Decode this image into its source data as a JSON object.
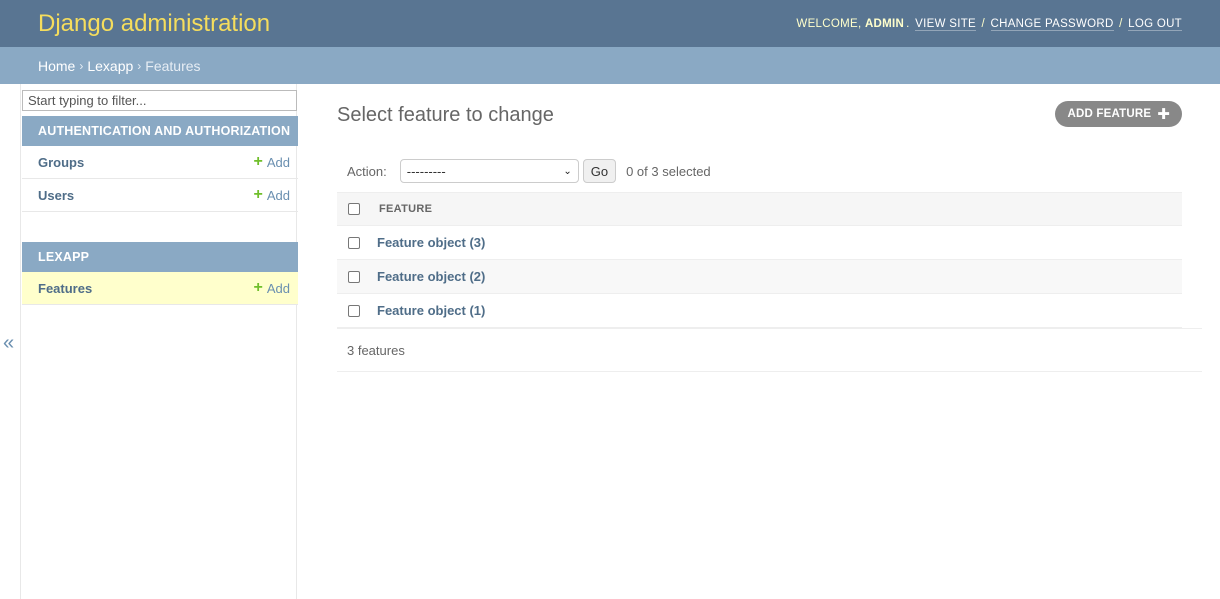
{
  "header": {
    "site_title": "Django administration",
    "welcome": "Welcome,",
    "username": "admin",
    "view_site": "View site",
    "change_password": "Change password",
    "log_out": "Log out"
  },
  "breadcrumbs": {
    "home": "Home",
    "app": "Lexapp",
    "current": "Features"
  },
  "sidebar": {
    "filter_placeholder": "Start typing to filter...",
    "modules": [
      {
        "caption": "Authentication and Authorization",
        "models": [
          {
            "name": "Groups",
            "add": "Add"
          },
          {
            "name": "Users",
            "add": "Add"
          }
        ]
      },
      {
        "caption": "Lexapp",
        "models": [
          {
            "name": "Features",
            "add": "Add",
            "current": true
          }
        ]
      }
    ],
    "toggle": "«"
  },
  "content": {
    "title": "Select feature to change",
    "add_button": "Add Feature",
    "actions": {
      "label": "Action:",
      "selected_option": "---------",
      "go": "Go",
      "counter": "0 of 3 selected"
    },
    "table": {
      "column": "Feature",
      "rows": [
        "Feature object (3)",
        "Feature object (2)",
        "Feature object (1)"
      ]
    },
    "paginator": "3 features"
  },
  "colors": {
    "header_bg": "#597592",
    "branding": "#f5dd5d",
    "breadcrumb_bg": "#8aa9c4",
    "add_icon": "#70bf2b"
  }
}
